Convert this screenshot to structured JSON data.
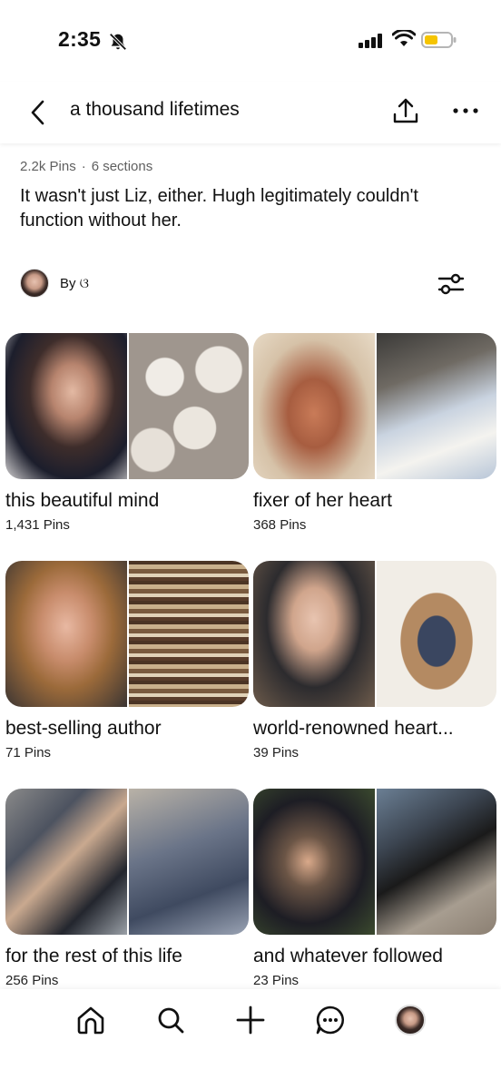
{
  "status_bar": {
    "time": "2:35",
    "battery_color": "#f5c400"
  },
  "header": {
    "title": "a thousand lifetimes",
    "back_icon": "chevron-left-icon",
    "share_icon": "share-upload-icon",
    "more_icon": "more-horizontal-icon"
  },
  "board": {
    "pin_count": "2.2k Pins",
    "separator": "·",
    "section_count": "6 sections",
    "description": "It wasn't just Liz, either. Hugh legitimately couldn't function without her.",
    "by_label": "By ଓ",
    "filter_icon": "sliders-icon"
  },
  "sections": [
    {
      "title": "this beautiful mind",
      "count": "1,431 Pins"
    },
    {
      "title": "fixer of her heart",
      "count": "368 Pins"
    },
    {
      "title": "best-selling author",
      "count": "71 Pins"
    },
    {
      "title": "world-renowned heart...",
      "count": "39 Pins"
    },
    {
      "title": "for the rest of this life",
      "count": "256 Pins"
    },
    {
      "title": "and whatever followed",
      "count": "23 Pins"
    }
  ],
  "bottom_nav": {
    "items": [
      "home-icon",
      "search-icon",
      "plus-icon",
      "messages-icon",
      "profile-avatar"
    ]
  }
}
